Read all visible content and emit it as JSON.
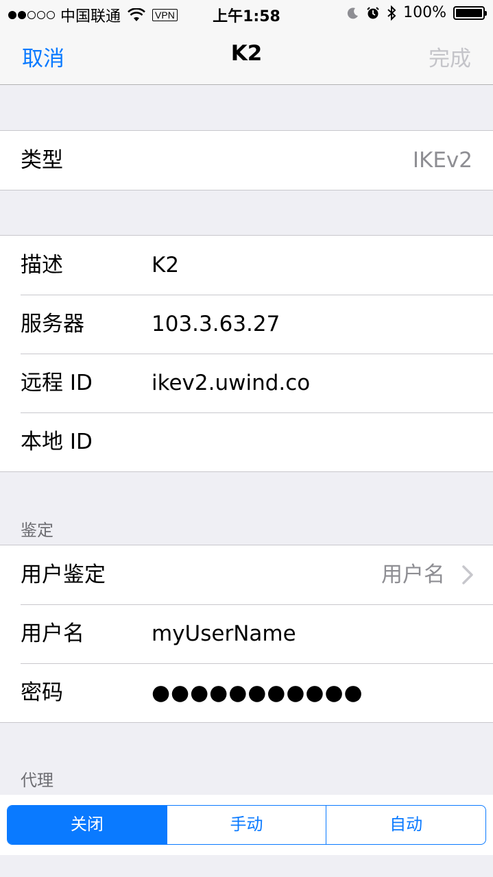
{
  "status_bar": {
    "carrier": "中国联通",
    "vpn": "VPN",
    "time": "上午1:58",
    "battery": "100%",
    "signal_strength": 2,
    "signal_max": 5
  },
  "nav": {
    "cancel": "取消",
    "title": "K2",
    "done": "完成"
  },
  "type_row": {
    "label": "类型",
    "value": "IKEv2"
  },
  "general": {
    "description": {
      "label": "描述",
      "value": "K2"
    },
    "server": {
      "label": "服务器",
      "value": "103.3.63.27"
    },
    "remote_id": {
      "label": "远程 ID",
      "value": "ikev2.uwind.co"
    },
    "local_id": {
      "label": "本地 ID",
      "value": ""
    }
  },
  "auth": {
    "header": "鉴定",
    "user_auth": {
      "label": "用户鉴定",
      "value": "用户名"
    },
    "username": {
      "label": "用户名",
      "value": "myUserName"
    },
    "password": {
      "label": "密码",
      "value": "●●●●●●●●●●●"
    }
  },
  "proxy": {
    "header": "代理",
    "options": [
      "关闭",
      "手动",
      "自动"
    ],
    "selected": "关闭"
  },
  "colors": {
    "accent": "#0a7aff",
    "background": "#efeff4",
    "secondary_text": "#8e8e93"
  }
}
